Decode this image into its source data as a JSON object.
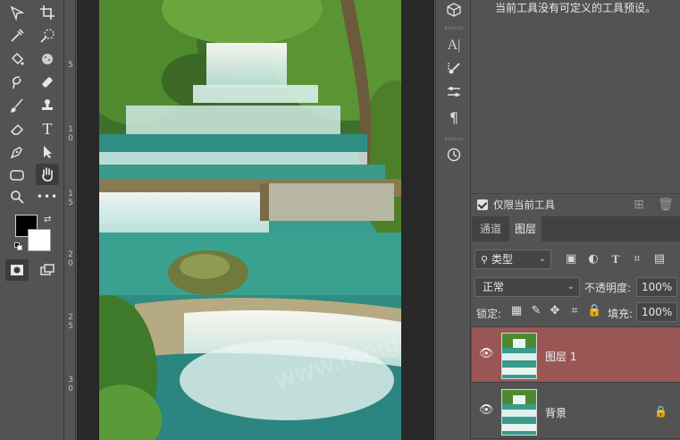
{
  "toolbar": {
    "tools": [
      {
        "name": "move-icon",
        "glyph": "✢"
      },
      {
        "name": "crop-icon",
        "glyph": "⌗"
      },
      {
        "name": "eyedropper-icon",
        "glyph": "✎"
      },
      {
        "name": "healing-icon",
        "glyph": "✚"
      },
      {
        "name": "brush-icon",
        "glyph": "✎"
      },
      {
        "name": "stamp-icon",
        "glyph": "⊥"
      },
      {
        "name": "eraser-icon",
        "glyph": "◇"
      },
      {
        "name": "text-icon",
        "glyph": "T"
      },
      {
        "name": "pen-icon",
        "glyph": "✒"
      },
      {
        "name": "select-arrow-icon",
        "glyph": "➤"
      },
      {
        "name": "shape-icon",
        "glyph": "▢"
      },
      {
        "name": "hand-icon",
        "glyph": "✋"
      },
      {
        "name": "zoom-icon",
        "glyph": "⚲"
      },
      {
        "name": "more-tools-icon",
        "glyph": "•••"
      }
    ]
  },
  "ruler": {
    "ticks": [
      "5",
      "1\n0",
      "1\n5",
      "2\n0",
      "2\n5",
      "3\n0"
    ]
  },
  "canvas": {
    "watermark": "www.meigongla.com"
  },
  "tool_presets": {
    "message": "当前工具没有可定义的工具预设。",
    "current_tool_only_label": "仅限当前工具"
  },
  "layers_panel": {
    "tabs": [
      {
        "label": "通道",
        "active": false
      },
      {
        "label": "图层",
        "active": true
      }
    ],
    "filter_kind": "类型",
    "blend_mode": "正常",
    "opacity_label": "不透明度:",
    "opacity_value": "100%",
    "lock_label": "锁定:",
    "fill_label": "填充:",
    "fill_value": "100%",
    "layers": [
      {
        "name": "图层 1",
        "selected": true,
        "locked": false
      },
      {
        "name": "背景",
        "selected": false,
        "locked": true
      }
    ]
  },
  "colors": {
    "foreground": "#000000",
    "background": "#ffffff",
    "selected_layer": "#9a5555"
  }
}
